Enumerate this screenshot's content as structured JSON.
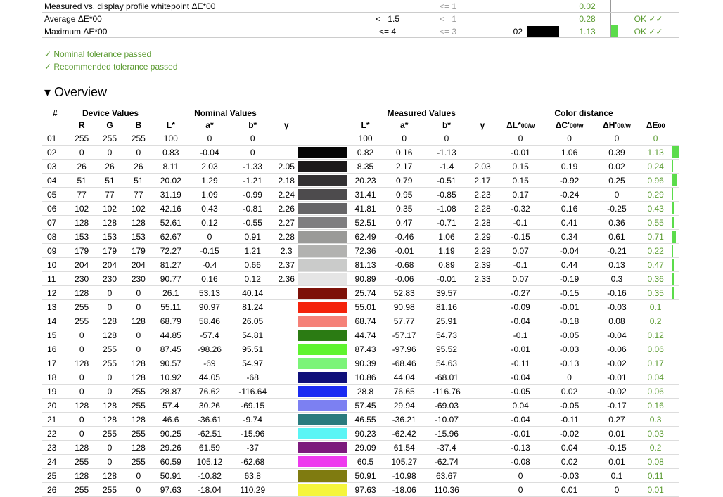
{
  "summary": [
    {
      "label": "Measured vs. display profile whitepoint ΔE*00",
      "nominal": "",
      "recommended": "<= 1",
      "number": "",
      "swatch": false,
      "measured": "0.02",
      "bar": 0,
      "result": ""
    },
    {
      "label": "Average ΔE*00",
      "nominal": "<= 1.5",
      "recommended": "<= 1",
      "number": "",
      "swatch": false,
      "measured": "0.28",
      "bar": 0,
      "result": "OK ✓✓"
    },
    {
      "label": "Maximum ΔE*00",
      "nominal": "<= 4",
      "recommended": "<= 3",
      "number": "02",
      "swatch": true,
      "measured": "1.13",
      "bar": 1.0,
      "result": "OK ✓✓"
    }
  ],
  "passes": [
    "✓ Nominal tolerance passed",
    "✓ Recommended tolerance passed"
  ],
  "overview_title": "▾ Overview",
  "headers": {
    "group": [
      "#",
      "Device Values",
      "Nominal Values",
      "Measured Values",
      "Color distance"
    ],
    "sub": [
      "R",
      "G",
      "B",
      "L*",
      "a*",
      "b*",
      "γ",
      "L*",
      "a*",
      "b*",
      "γ",
      "ΔL*00/w",
      "ΔC'00/w",
      "ΔH'00/w",
      "ΔE00"
    ]
  },
  "rows": [
    {
      "id": "01",
      "rgb": [
        "255",
        "255",
        "255"
      ],
      "nom": [
        "100",
        "0",
        "0",
        ""
      ],
      "color": "#ffffff",
      "meas": [
        "100",
        "0",
        "0",
        ""
      ],
      "dist": [
        "0",
        "0",
        "0",
        "0"
      ],
      "bar": 0
    },
    {
      "id": "02",
      "rgb": [
        "0",
        "0",
        "0"
      ],
      "nom": [
        "0.83",
        "-0.04",
        "0",
        ""
      ],
      "color": "#050505",
      "meas": [
        "0.82",
        "0.16",
        "-1.13",
        ""
      ],
      "dist": [
        "-0.01",
        "1.06",
        "0.39",
        "1.13"
      ],
      "bar": 1.0
    },
    {
      "id": "03",
      "rgb": [
        "26",
        "26",
        "26"
      ],
      "nom": [
        "8.11",
        "2.03",
        "-1.33",
        "2.05"
      ],
      "color": "#1c1a1b",
      "meas": [
        "8.35",
        "2.17",
        "-1.4",
        "2.03"
      ],
      "dist": [
        "0.15",
        "0.19",
        "0.02",
        "0.24"
      ],
      "bar": 0.2
    },
    {
      "id": "04",
      "rgb": [
        "51",
        "51",
        "51"
      ],
      "nom": [
        "20.02",
        "1.29",
        "-1.21",
        "2.18"
      ],
      "color": "#333133",
      "meas": [
        "20.23",
        "0.79",
        "-0.51",
        "2.17"
      ],
      "dist": [
        "0.15",
        "-0.92",
        "0.25",
        "0.96"
      ],
      "bar": 0.85
    },
    {
      "id": "05",
      "rgb": [
        "77",
        "77",
        "77"
      ],
      "nom": [
        "31.19",
        "1.09",
        "-0.99",
        "2.24"
      ],
      "color": "#4d4b4d",
      "meas": [
        "31.41",
        "0.95",
        "-0.85",
        "2.23"
      ],
      "dist": [
        "0.17",
        "-0.24",
        "0",
        "0.29"
      ],
      "bar": 0.25
    },
    {
      "id": "06",
      "rgb": [
        "102",
        "102",
        "102"
      ],
      "nom": [
        "42.16",
        "0.43",
        "-0.81",
        "2.26"
      ],
      "color": "#666567",
      "meas": [
        "41.81",
        "0.35",
        "-1.08",
        "2.28"
      ],
      "dist": [
        "-0.32",
        "0.16",
        "-0.25",
        "0.43"
      ],
      "bar": 0.38
    },
    {
      "id": "07",
      "rgb": [
        "128",
        "128",
        "128"
      ],
      "nom": [
        "52.61",
        "0.12",
        "-0.55",
        "2.27"
      ],
      "color": "#7f7e80",
      "meas": [
        "52.51",
        "0.47",
        "-0.71",
        "2.28"
      ],
      "dist": [
        "-0.1",
        "0.41",
        "0.36",
        "0.55"
      ],
      "bar": 0.48
    },
    {
      "id": "08",
      "rgb": [
        "153",
        "153",
        "153"
      ],
      "nom": [
        "62.67",
        "0",
        "0.91",
        "2.28"
      ],
      "color": "#9a9a98",
      "meas": [
        "62.49",
        "-0.46",
        "1.06",
        "2.29"
      ],
      "dist": [
        "-0.15",
        "0.34",
        "0.61",
        "0.71"
      ],
      "bar": 0.62
    },
    {
      "id": "09",
      "rgb": [
        "179",
        "179",
        "179"
      ],
      "nom": [
        "72.27",
        "-0.15",
        "1.21",
        "2.3"
      ],
      "color": "#b2b2b0",
      "meas": [
        "72.36",
        "-0.01",
        "1.19",
        "2.29"
      ],
      "dist": [
        "0.07",
        "-0.04",
        "-0.21",
        "0.22"
      ],
      "bar": 0.2
    },
    {
      "id": "10",
      "rgb": [
        "204",
        "204",
        "204"
      ],
      "nom": [
        "81.27",
        "-0.4",
        "0.66",
        "2.37"
      ],
      "color": "#cacbca",
      "meas": [
        "81.13",
        "-0.68",
        "0.89",
        "2.39"
      ],
      "dist": [
        "-0.1",
        "0.44",
        "0.13",
        "0.47"
      ],
      "bar": 0.42
    },
    {
      "id": "11",
      "rgb": [
        "230",
        "230",
        "230"
      ],
      "nom": [
        "90.77",
        "0.16",
        "0.12",
        "2.36"
      ],
      "color": "#e5e5e5",
      "meas": [
        "90.89",
        "-0.06",
        "-0.01",
        "2.33"
      ],
      "dist": [
        "0.07",
        "-0.19",
        "0.3",
        "0.36"
      ],
      "bar": 0.32
    },
    {
      "id": "12",
      "rgb": [
        "128",
        "0",
        "0"
      ],
      "nom": [
        "26.1",
        "53.13",
        "40.14",
        ""
      ],
      "color": "#7d1108",
      "meas": [
        "25.74",
        "52.83",
        "39.57",
        ""
      ],
      "dist": [
        "-0.27",
        "-0.15",
        "-0.16",
        "0.35"
      ],
      "bar": 0.31
    },
    {
      "id": "13",
      "rgb": [
        "255",
        "0",
        "0"
      ],
      "nom": [
        "55.11",
        "90.97",
        "81.24",
        ""
      ],
      "color": "#f4230b",
      "meas": [
        "55.01",
        "90.98",
        "81.16",
        ""
      ],
      "dist": [
        "-0.09",
        "-0.01",
        "-0.03",
        "0.1"
      ],
      "bar": 0
    },
    {
      "id": "14",
      "rgb": [
        "255",
        "128",
        "128"
      ],
      "nom": [
        "68.79",
        "58.46",
        "26.05",
        ""
      ],
      "color": "#f58178",
      "meas": [
        "68.74",
        "57.77",
        "25.91",
        ""
      ],
      "dist": [
        "-0.04",
        "-0.18",
        "0.08",
        "0.2"
      ],
      "bar": 0
    },
    {
      "id": "15",
      "rgb": [
        "0",
        "128",
        "0"
      ],
      "nom": [
        "44.85",
        "-57.4",
        "54.81",
        ""
      ],
      "color": "#2b7b13",
      "meas": [
        "44.74",
        "-57.17",
        "54.73",
        ""
      ],
      "dist": [
        "-0.1",
        "-0.05",
        "-0.04",
        "0.12"
      ],
      "bar": 0
    },
    {
      "id": "16",
      "rgb": [
        "0",
        "255",
        "0"
      ],
      "nom": [
        "87.45",
        "-98.26",
        "95.51",
        ""
      ],
      "color": "#5ef42e",
      "meas": [
        "87.43",
        "-97.96",
        "95.52",
        ""
      ],
      "dist": [
        "-0.01",
        "-0.03",
        "-0.06",
        "0.06"
      ],
      "bar": 0
    },
    {
      "id": "17",
      "rgb": [
        "128",
        "255",
        "128"
      ],
      "nom": [
        "90.57",
        "-69",
        "54.97",
        ""
      ],
      "color": "#7bf478",
      "meas": [
        "90.39",
        "-68.46",
        "54.63",
        ""
      ],
      "dist": [
        "-0.11",
        "-0.13",
        "-0.02",
        "0.17"
      ],
      "bar": 0
    },
    {
      "id": "18",
      "rgb": [
        "0",
        "0",
        "128"
      ],
      "nom": [
        "10.92",
        "44.05",
        "-68",
        ""
      ],
      "color": "#0f0f7a",
      "meas": [
        "10.86",
        "44.04",
        "-68.01",
        ""
      ],
      "dist": [
        "-0.04",
        "0",
        "-0.01",
        "0.04"
      ],
      "bar": 0
    },
    {
      "id": "19",
      "rgb": [
        "0",
        "0",
        "255"
      ],
      "nom": [
        "28.87",
        "76.62",
        "-116.64",
        ""
      ],
      "color": "#1a2bf2",
      "meas": [
        "28.8",
        "76.65",
        "-116.76",
        ""
      ],
      "dist": [
        "-0.05",
        "0.02",
        "-0.02",
        "0.06"
      ],
      "bar": 0
    },
    {
      "id": "20",
      "rgb": [
        "128",
        "128",
        "255"
      ],
      "nom": [
        "57.4",
        "30.26",
        "-69.15",
        ""
      ],
      "color": "#7c80f2",
      "meas": [
        "57.45",
        "29.94",
        "-69.03",
        ""
      ],
      "dist": [
        "0.04",
        "-0.05",
        "-0.17",
        "0.16"
      ],
      "bar": 0
    },
    {
      "id": "21",
      "rgb": [
        "0",
        "128",
        "128"
      ],
      "nom": [
        "46.6",
        "-36.61",
        "-9.74",
        ""
      ],
      "color": "#2a7b7e",
      "meas": [
        "46.55",
        "-36.21",
        "-10.07",
        ""
      ],
      "dist": [
        "-0.04",
        "-0.11",
        "0.27",
        "0.3"
      ],
      "bar": 0
    },
    {
      "id": "22",
      "rgb": [
        "0",
        "255",
        "255"
      ],
      "nom": [
        "90.25",
        "-62.51",
        "-15.96",
        ""
      ],
      "color": "#5af5f5",
      "meas": [
        "90.23",
        "-62.42",
        "-15.96",
        ""
      ],
      "dist": [
        "-0.01",
        "-0.02",
        "0.01",
        "0.03"
      ],
      "bar": 0
    },
    {
      "id": "23",
      "rgb": [
        "128",
        "0",
        "128"
      ],
      "nom": [
        "29.26",
        "61.59",
        "-37",
        ""
      ],
      "color": "#7c1a7c",
      "meas": [
        "29.09",
        "61.54",
        "-37.4",
        ""
      ],
      "dist": [
        "-0.13",
        "0.04",
        "-0.15",
        "0.2"
      ],
      "bar": 0
    },
    {
      "id": "24",
      "rgb": [
        "255",
        "0",
        "255"
      ],
      "nom": [
        "60.59",
        "105.12",
        "-62.68",
        ""
      ],
      "color": "#ee3aee",
      "meas": [
        "60.5",
        "105.27",
        "-62.74",
        ""
      ],
      "dist": [
        "-0.08",
        "0.02",
        "0.01",
        "0.08"
      ],
      "bar": 0
    },
    {
      "id": "25",
      "rgb": [
        "128",
        "128",
        "0"
      ],
      "nom": [
        "50.91",
        "-10.82",
        "63.8",
        ""
      ],
      "color": "#7f7b10",
      "meas": [
        "50.91",
        "-10.98",
        "63.67",
        ""
      ],
      "dist": [
        "0",
        "-0.03",
        "0.1",
        "0.11"
      ],
      "bar": 0
    },
    {
      "id": "26",
      "rgb": [
        "255",
        "255",
        "0"
      ],
      "nom": [
        "97.63",
        "-18.04",
        "110.29",
        ""
      ],
      "color": "#f5f53c",
      "meas": [
        "97.63",
        "-18.06",
        "110.36",
        ""
      ],
      "dist": [
        "0",
        "0.01",
        "0",
        "0.01"
      ],
      "bar": 0
    }
  ],
  "colors": {
    "accent_green": "#5bdc4b",
    "text_green": "#5a9a30"
  }
}
